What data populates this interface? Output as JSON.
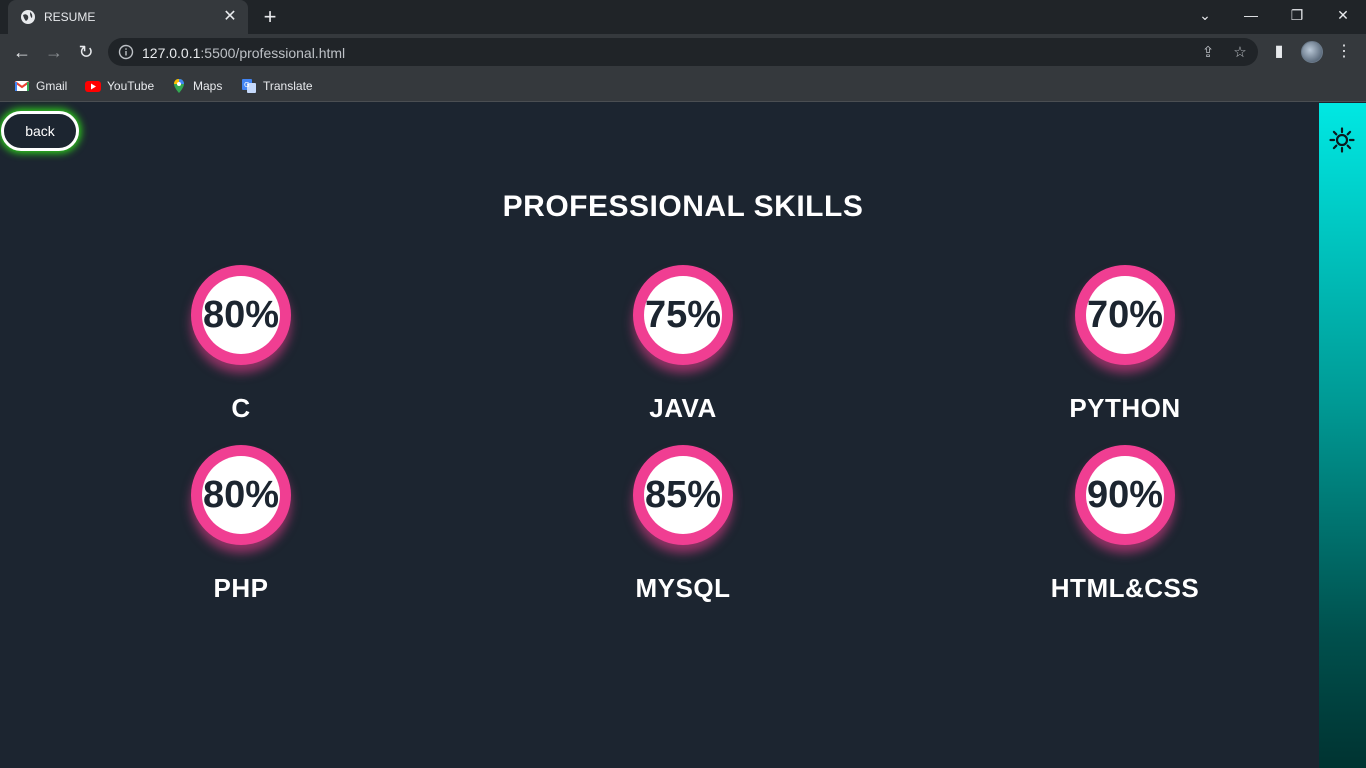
{
  "browser": {
    "tab_title": "RESUME",
    "url_host": "127.0.0.1",
    "url_rest": ":5500/professional.html",
    "bookmarks": [
      {
        "label": "Gmail",
        "icon": "gmail-icon"
      },
      {
        "label": "YouTube",
        "icon": "youtube-icon"
      },
      {
        "label": "Maps",
        "icon": "maps-icon"
      },
      {
        "label": "Translate",
        "icon": "translate-icon"
      }
    ]
  },
  "page": {
    "back_label": "back",
    "heading": "PROFESSIONAL SKILLS",
    "theme_toggle_icon": "sun-icon",
    "colors": {
      "background": "#1c2530",
      "ring": "#f03e92",
      "back_glow": "#2fdb1a",
      "sidebar_top": "#00e8e3",
      "sidebar_bottom": "#003331"
    },
    "skills": [
      {
        "name": "C",
        "percent": "80%"
      },
      {
        "name": "JAVA",
        "percent": "75%"
      },
      {
        "name": "PYTHON",
        "percent": "70%"
      },
      {
        "name": "PHP",
        "percent": "80%"
      },
      {
        "name": "MYSQL",
        "percent": "85%"
      },
      {
        "name": "HTML&CSS",
        "percent": "90%"
      }
    ]
  }
}
